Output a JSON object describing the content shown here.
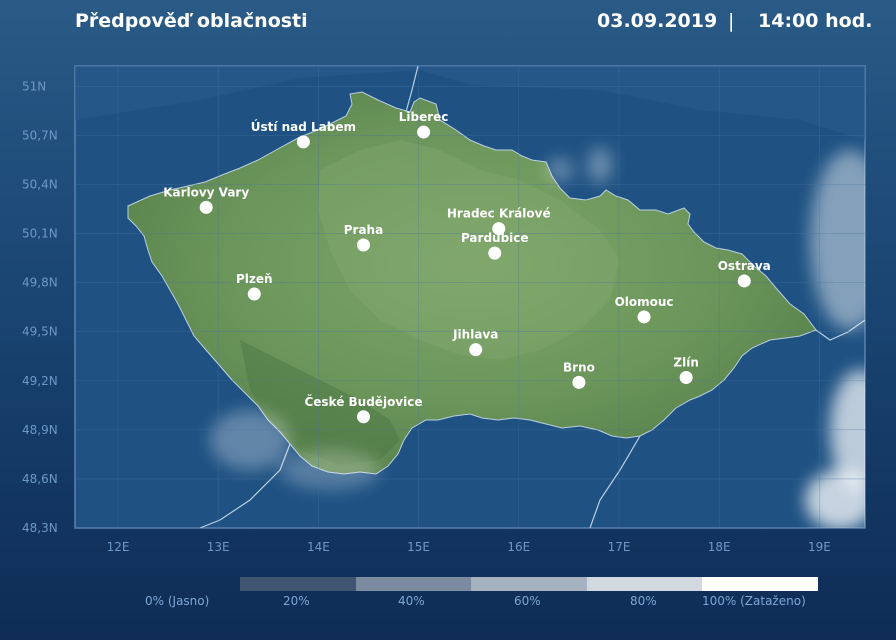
{
  "header": {
    "title": "Předpověď oblačnosti",
    "date": "03.09.2019",
    "separator": "|",
    "time": "14:00 hod."
  },
  "map": {
    "latitude_range": [
      48.3,
      51.1
    ],
    "longitude_range": [
      11.6,
      19.5
    ],
    "lat_ticks": [
      {
        "value": 51.0,
        "label": "51N"
      },
      {
        "value": 50.7,
        "label": "50,7N"
      },
      {
        "value": 50.4,
        "label": "50,4N"
      },
      {
        "value": 50.1,
        "label": "50,1N"
      },
      {
        "value": 49.8,
        "label": "49,8N"
      },
      {
        "value": 49.5,
        "label": "49,5N"
      },
      {
        "value": 49.2,
        "label": "49,2N"
      },
      {
        "value": 48.9,
        "label": "48,9N"
      },
      {
        "value": 48.6,
        "label": "48,6N"
      },
      {
        "value": 48.3,
        "label": "48,3N"
      }
    ],
    "lon_ticks": [
      {
        "value": 12,
        "label": "12E"
      },
      {
        "value": 13,
        "label": "13E"
      },
      {
        "value": 14,
        "label": "14E"
      },
      {
        "value": 15,
        "label": "15E"
      },
      {
        "value": 16,
        "label": "16E"
      },
      {
        "value": 17,
        "label": "17E"
      },
      {
        "value": 18,
        "label": "18E"
      },
      {
        "value": 19,
        "label": "19E"
      }
    ],
    "cities": [
      {
        "name": "Ústí nad Labem",
        "lon": 13.85,
        "lat": 50.66,
        "label_pos": "above"
      },
      {
        "name": "Liberec",
        "lon": 15.05,
        "lat": 50.72,
        "label_pos": "above"
      },
      {
        "name": "Karlovy Vary",
        "lon": 12.88,
        "lat": 50.26,
        "label_pos": "above"
      },
      {
        "name": "Hradec Králové",
        "lon": 15.8,
        "lat": 50.13,
        "label_pos": "above"
      },
      {
        "name": "Praha",
        "lon": 14.45,
        "lat": 50.03,
        "label_pos": "above"
      },
      {
        "name": "Pardubice",
        "lon": 15.76,
        "lat": 49.98,
        "label_pos": "above"
      },
      {
        "name": "Plzeň",
        "lon": 13.36,
        "lat": 49.73,
        "label_pos": "above"
      },
      {
        "name": "Ostrava",
        "lon": 18.25,
        "lat": 49.81,
        "label_pos": "above"
      },
      {
        "name": "Olomouc",
        "lon": 17.25,
        "lat": 49.59,
        "label_pos": "above"
      },
      {
        "name": "Jihlava",
        "lon": 15.57,
        "lat": 49.39,
        "label_pos": "above"
      },
      {
        "name": "Zlín",
        "lon": 17.67,
        "lat": 49.22,
        "label_pos": "above"
      },
      {
        "name": "Brno",
        "lon": 16.6,
        "lat": 49.19,
        "label_pos": "above"
      },
      {
        "name": "České Budějovice",
        "lon": 14.45,
        "lat": 48.98,
        "label_pos": "above"
      }
    ],
    "colors": {
      "land": "#6f9a5c",
      "land_dark": "#4f7a45",
      "sea": "#1d4f80",
      "frame": "#5a82b0",
      "city_dot": "#ffffff"
    }
  },
  "legend": {
    "labels": [
      "0% (Jasno)",
      "20%",
      "40%",
      "60%",
      "80%",
      "100% (Zataženo)"
    ],
    "swatches": [
      "#3f5570",
      "#7b8ba0",
      "#a7b2c0",
      "#d2d8df",
      "#ffffff"
    ]
  }
}
